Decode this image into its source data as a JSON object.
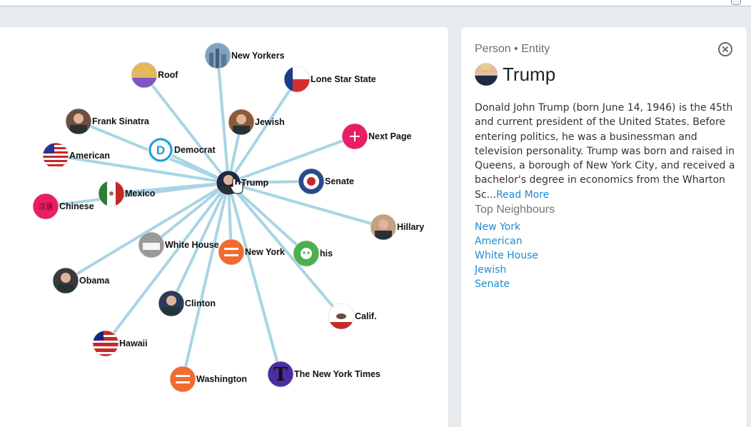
{
  "colors": {
    "edge": "#a8d5e5",
    "link": "#1e8bd1",
    "next_page": "#e91e63"
  },
  "graph": {
    "center": {
      "label": "Trump",
      "icon": "trump-photo"
    },
    "nodes": [
      {
        "label": "New Yorkers",
        "icon": "city-skyline-icon"
      },
      {
        "label": "Roof",
        "icon": "roof-sketch-icon"
      },
      {
        "label": "Lone Star State",
        "icon": "texas-flag-icon"
      },
      {
        "label": "Frank Sinatra",
        "icon": "sinatra-photo"
      },
      {
        "label": "Jewish",
        "icon": "painting-icon"
      },
      {
        "label": "Next Page",
        "icon": "plus-icon"
      },
      {
        "label": "Democrat",
        "icon": "democrat-logo-icon"
      },
      {
        "label": "American",
        "icon": "us-flag-icon"
      },
      {
        "label": "Senate",
        "icon": "senate-seal-icon"
      },
      {
        "label": "Mexico",
        "icon": "mexico-flag-icon"
      },
      {
        "label": "Chinese",
        "icon": "chinese-characters-icon"
      },
      {
        "label": "Hillary",
        "icon": "hillary-photo"
      },
      {
        "label": "White House",
        "icon": "white-house-photo"
      },
      {
        "label": "New York",
        "icon": "placeholder-logo-icon"
      },
      {
        "label": "his",
        "icon": "smiley-icon"
      },
      {
        "label": "Obama",
        "icon": "obama-photo"
      },
      {
        "label": "Clinton",
        "icon": "clinton-photo"
      },
      {
        "label": "Calif.",
        "icon": "california-flag-icon"
      },
      {
        "label": "Hawaii",
        "icon": "hawaii-flag-icon"
      },
      {
        "label": "Washington",
        "icon": "placeholder-logo-icon"
      },
      {
        "label": "The New York Times",
        "icon": "nyt-logo-icon"
      }
    ]
  },
  "info": {
    "type_line": "Person • Entity",
    "title": "Trump",
    "description": "Donald John Trump (born June 14, 1946) is the 45th and current president of the United States. Before entering politics, he was a businessman and television personality. Trump was born and raised in Queens, a borough of New York City, and received a bachelor's degree in economics from the Wharton Sc...",
    "read_more": "Read More",
    "neighbours_heading": "Top Neighbours",
    "neighbours": [
      "New York",
      "American",
      "White House",
      "Jewish",
      "Senate"
    ]
  }
}
